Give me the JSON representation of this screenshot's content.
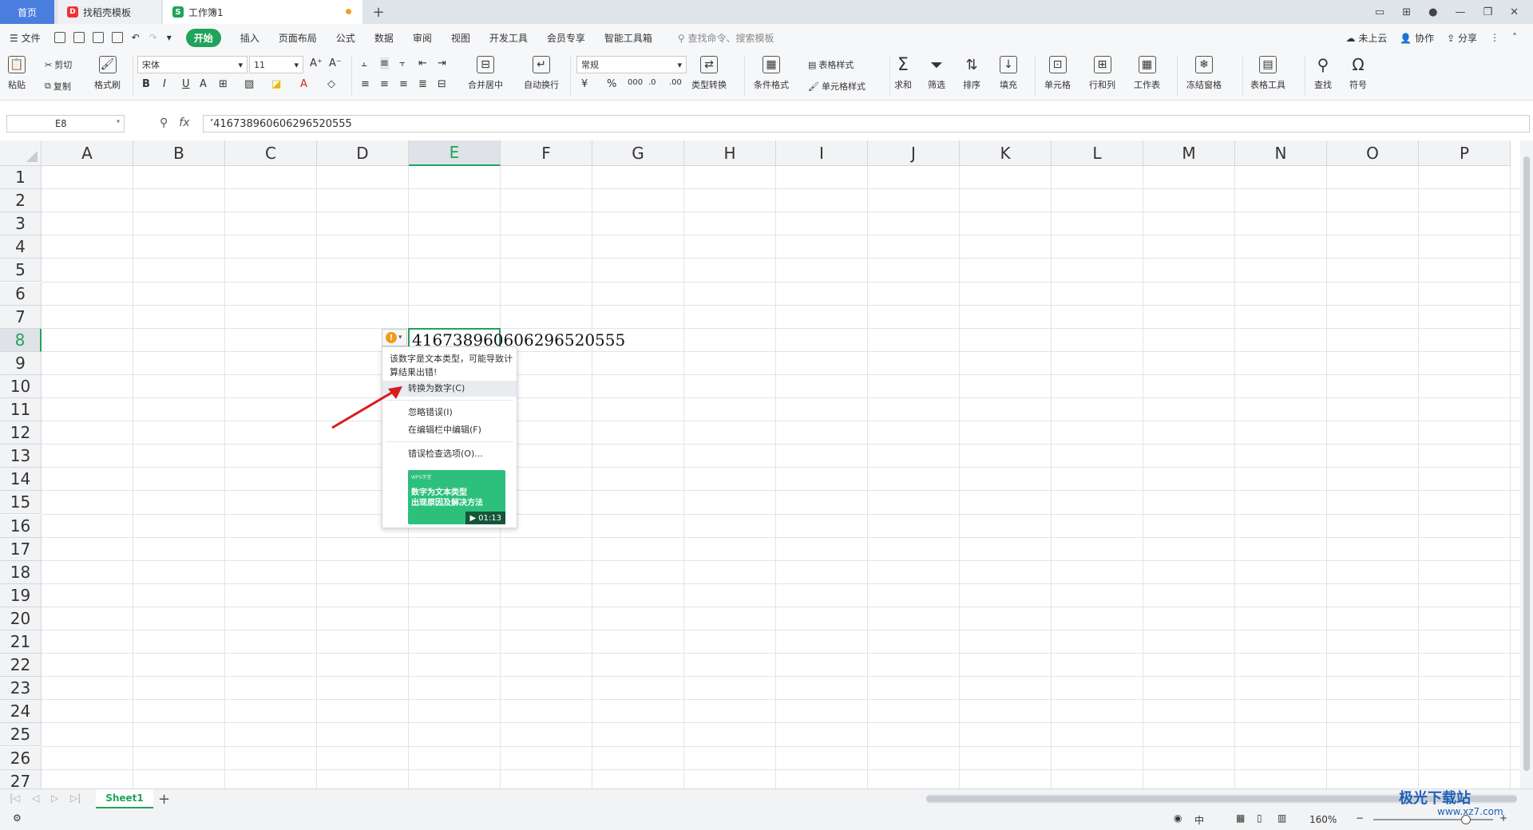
{
  "tabs": {
    "home": "首页",
    "template": "找稻壳模板",
    "workbook": "工作簿1",
    "add": "+"
  },
  "menu": {
    "file": "文件",
    "items": [
      "开始",
      "插入",
      "页面布局",
      "公式",
      "数据",
      "审阅",
      "视图",
      "开发工具",
      "会员专享",
      "智能工具箱"
    ],
    "search": "查找命令、搜索模板",
    "right": [
      "未上云",
      "协作",
      "分享"
    ]
  },
  "ribbon": {
    "paste": "粘贴",
    "cut": "剪切",
    "copy": "复制",
    "format_painter": "格式刷",
    "font": "宋体",
    "font_size": "11",
    "number_format": "常规",
    "merge": "合并居中",
    "wrap": "自动换行",
    "type_convert": "类型转换",
    "cond_format": "条件格式",
    "table_style": "表格样式",
    "cell_style": "单元格样式",
    "sum": "求和",
    "filter": "筛选",
    "sort": "排序",
    "fill": "填充",
    "cell": "单元格",
    "rowcol": "行和列",
    "worksheet": "工作表",
    "freeze": "冻结窗格",
    "table_tools": "表格工具",
    "find": "查找",
    "symbol": "符号"
  },
  "formula_bar": {
    "name_box": "E8",
    "fx": "fx",
    "content": "’416738960606296520555"
  },
  "columns": [
    "A",
    "B",
    "C",
    "D",
    "E",
    "F",
    "G",
    "H",
    "I",
    "J",
    "K",
    "L",
    "M",
    "N",
    "O",
    "P"
  ],
  "rows": [
    "1",
    "2",
    "3",
    "4",
    "5",
    "6",
    "7",
    "8",
    "9",
    "10",
    "11",
    "12",
    "13",
    "14",
    "15",
    "16",
    "17",
    "18",
    "19",
    "20",
    "21",
    "22",
    "23",
    "24",
    "25",
    "26",
    "27"
  ],
  "selected": {
    "column": "E",
    "row": "8"
  },
  "cell_e8": "416738960606296520555",
  "error_popup": {
    "tip": "该数字是文本类型，可能导致计算结果出错!",
    "convert": "转换为数字(C)",
    "ignore": "忽略错误(I)",
    "edit": "在编辑栏中编辑(F)",
    "options": "错误检查选项(O)...",
    "video_brand": "WPS学堂",
    "video_title_1": "数字为文本类型",
    "video_title_2": "出现原因及解决方法",
    "video_duration": "01:13"
  },
  "sheets": {
    "active": "Sheet1",
    "add": "+"
  },
  "status": {
    "zoom": "160%",
    "input": "中"
  },
  "watermark": {
    "title": "极光下载站",
    "url": "www.xz7.com"
  },
  "colors": {
    "accent": "#20a35b",
    "tab_home": "#4a7ede",
    "error": "#f29b1d",
    "arrow": "#d91c1c"
  }
}
